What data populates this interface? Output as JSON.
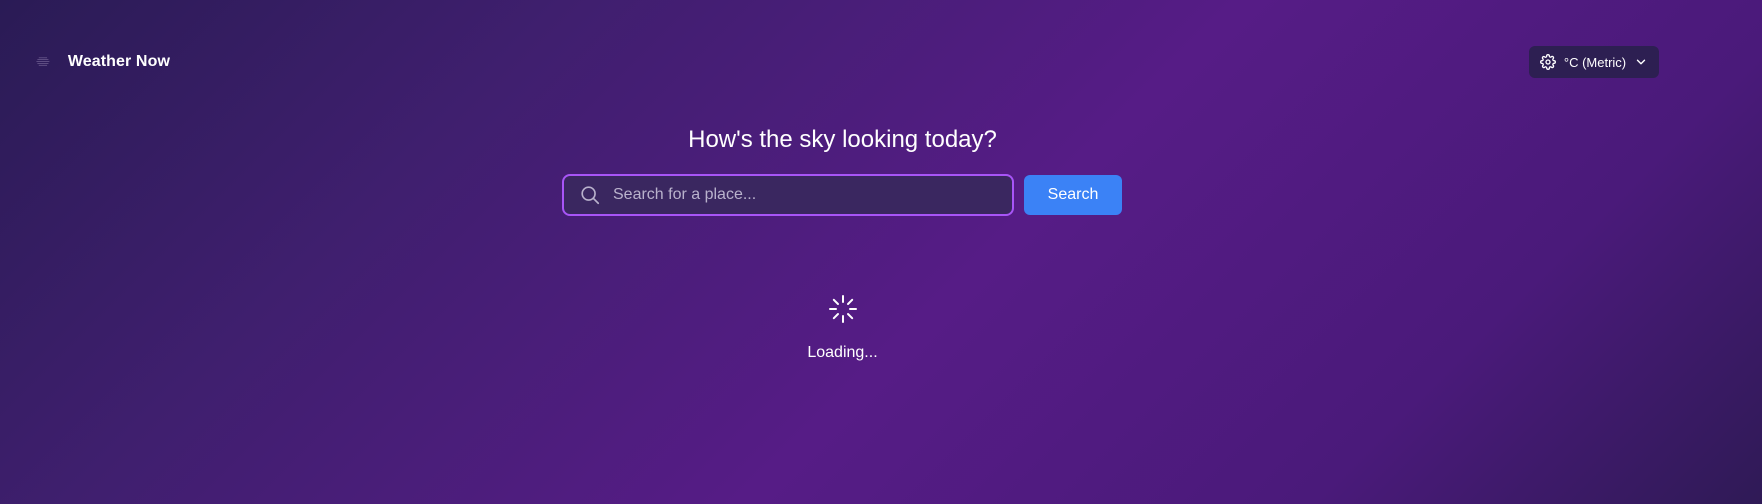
{
  "header": {
    "brand": "Weather Now",
    "logo_icon": "weather-lines-icon",
    "units_button": {
      "label": "°C (Metric)",
      "icon": "gear-icon",
      "chevron": "chevron-down-icon"
    }
  },
  "main": {
    "headline": "How's the sky looking today?",
    "search": {
      "placeholder": "Search for a place...",
      "value": "",
      "button_label": "Search",
      "icon": "search-icon"
    },
    "loading": {
      "text": "Loading...",
      "icon": "spinner-icon"
    }
  },
  "colors": {
    "accent_border": "#a855f7",
    "button_blue": "#3b82f6",
    "input_bg": "#3a2760",
    "units_bg": "#2d1f52"
  }
}
